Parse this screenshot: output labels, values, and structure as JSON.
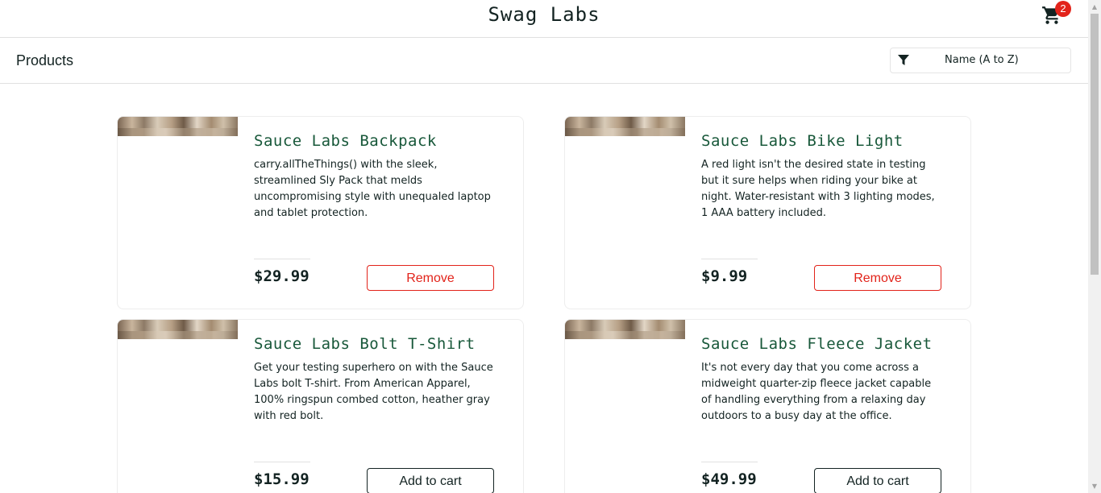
{
  "header": {
    "app_logo": "Swag Labs",
    "cart_count": "2"
  },
  "secondary": {
    "title": "Products",
    "sort_label": "Name (A to Z)"
  },
  "products": [
    {
      "name": "Sauce Labs Backpack",
      "description": "carry.allTheThings() with the sleek, streamlined Sly Pack that melds uncompromising style with unequaled laptop and tablet protection.",
      "price": "$29.99",
      "button": "Remove"
    },
    {
      "name": "Sauce Labs Bike Light",
      "description": "A red light isn't the desired state in testing but it sure helps when riding your bike at night. Water-resistant with 3 lighting modes, 1 AAA battery included.",
      "price": "$9.99",
      "button": "Remove"
    },
    {
      "name": "Sauce Labs Bolt T-Shirt",
      "description": "Get your testing superhero on with the Sauce Labs bolt T-shirt. From American Apparel, 100% ringspun combed cotton, heather gray with red bolt.",
      "price": "$15.99",
      "button": "Add to cart"
    },
    {
      "name": "Sauce Labs Fleece Jacket",
      "description": "It's not every day that you come across a midweight quarter-zip fleece jacket capable of handling everything from a relaxing day outdoors to a busy day at the office.",
      "price": "$49.99",
      "button": "Add to cart"
    }
  ],
  "colors": {
    "accent_green": "#18583a",
    "remove_red": "#e2231a",
    "badge_red": "#e2231a",
    "text": "#132322"
  }
}
